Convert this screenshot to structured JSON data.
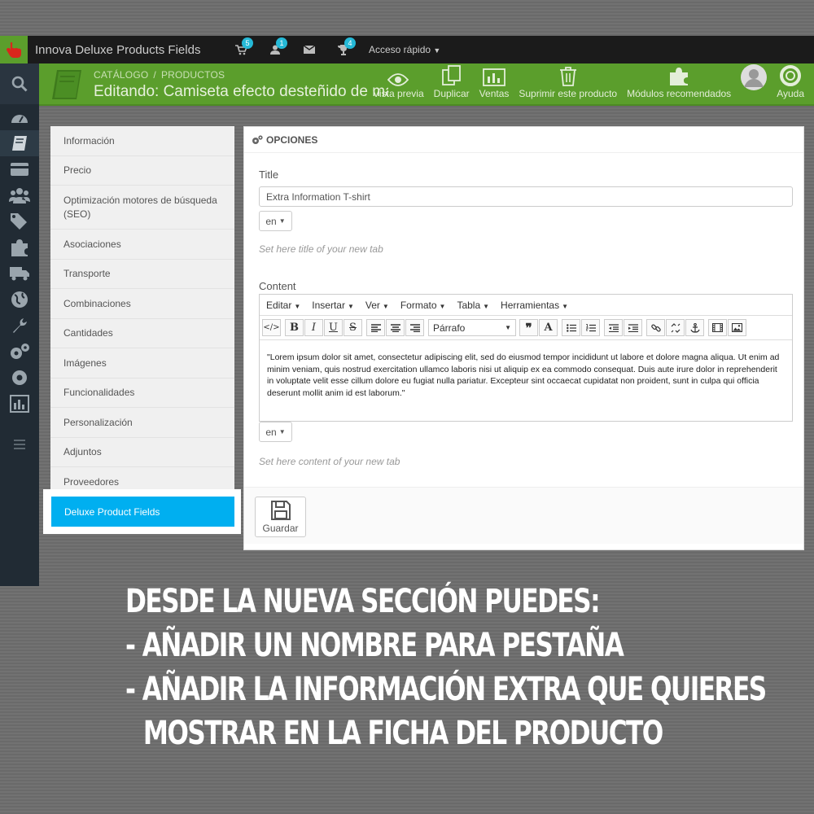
{
  "app": {
    "title": "Innova Deluxe Products Fields",
    "badges": {
      "orders": "5",
      "customers": "1",
      "trophy": "4"
    },
    "quick_access": "Acceso rápido",
    "brand_color": "#5b9e2c",
    "accent_color": "#00aff0"
  },
  "header": {
    "breadcrumb": [
      "CATÁLOGO",
      "PRODUCTOS"
    ],
    "title": "Editando: Camiseta efecto desteñido de manga corta",
    "actions": [
      {
        "label": "Vista previa",
        "icon": "eye-icon"
      },
      {
        "label": "Duplicar",
        "icon": "copy-icon"
      },
      {
        "label": "Ventas",
        "icon": "bar-chart-icon"
      },
      {
        "label": "Suprimir este producto",
        "icon": "trash-icon"
      },
      {
        "label": "Módulos recomendados",
        "icon": "puzzle-icon"
      },
      {
        "label": "Ayuda",
        "icon": "lifebuoy-icon"
      }
    ]
  },
  "tabs": [
    "Información",
    "Precio",
    "Optimización motores de búsqueda (SEO)",
    "Asociaciones",
    "Transporte",
    "Combinaciones",
    "Cantidades",
    "Imágenes",
    "Funcionalidades",
    "Personalización",
    "Adjuntos",
    "Proveedores",
    "Deluxe Product Fields"
  ],
  "panel": {
    "heading": "OPCIONES",
    "title_label": "Title",
    "title_value": "Extra Information T-shirt",
    "lang": "en",
    "title_help": "Set here title of your new tab",
    "content_label": "Content",
    "menus": [
      "Editar",
      "Insertar",
      "Ver",
      "Formato",
      "Tabla",
      "Herramientas"
    ],
    "format_select": "Párrafo",
    "content_text": "\"Lorem ipsum dolor sit amet, consectetur adipiscing elit, sed do eiusmod tempor incididunt ut labore et dolore magna aliqua. Ut enim ad minim veniam, quis nostrud exercitation ullamco laboris nisi ut aliquip ex ea commodo consequat. Duis aute irure dolor in reprehenderit in voluptate velit esse cillum dolore eu fugiat nulla pariatur. Excepteur sint occaecat cupidatat non proident, sunt in culpa qui officia deserunt mollit anim id est laborum.\"",
    "content_help": "Set here content of your new tab",
    "save_label": "Guardar"
  },
  "caption": {
    "line1": "Desde la nueva sección puedes:",
    "line2": "- Añadir un nombre para pestaña",
    "line3": "- Añadir la información extra que quieres",
    "line4": "mostrar en la ficha del producto"
  }
}
